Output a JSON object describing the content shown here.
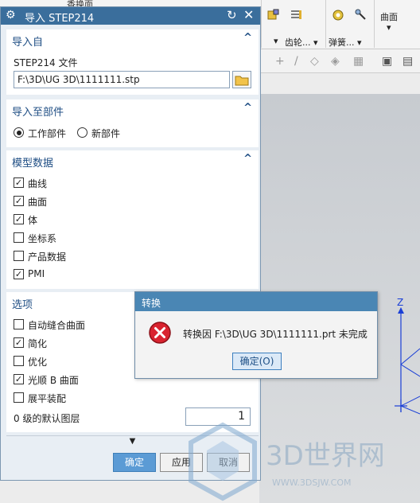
{
  "ribbon": {
    "top_label": "香换面",
    "items": [
      {
        "label": "齿轮...",
        "icon": "gear-tooth-icon"
      },
      {
        "label": "弹簧...",
        "icon": "spring-icon"
      },
      {
        "label": "曲面",
        "icon": "surface-icon"
      }
    ]
  },
  "dialog": {
    "title": "导入 STEP214",
    "import_from": {
      "header": "导入自",
      "file_label": "STEP214 文件",
      "file_path": "F:\\3D\\UG 3D\\1111111.stp"
    },
    "import_to": {
      "header": "导入至部件",
      "options": [
        {
          "label": "工作部件",
          "selected": true
        },
        {
          "label": "新部件",
          "selected": false
        }
      ]
    },
    "model_data": {
      "header": "模型数据",
      "items": [
        {
          "label": "曲线",
          "checked": true
        },
        {
          "label": "曲面",
          "checked": true
        },
        {
          "label": "体",
          "checked": true
        },
        {
          "label": "坐标系",
          "checked": false
        },
        {
          "label": "产品数据",
          "checked": false
        },
        {
          "label": "PMI",
          "checked": true
        }
      ]
    },
    "options": {
      "header": "选项",
      "items": [
        {
          "label": "自动缝合曲面",
          "checked": false
        },
        {
          "label": "简化",
          "checked": true
        },
        {
          "label": "优化",
          "checked": false
        },
        {
          "label": "光顺 B 曲面",
          "checked": true
        },
        {
          "label": "展平装配",
          "checked": false
        }
      ],
      "layer_label": "0 级的默认图层",
      "layer_value": "1"
    },
    "buttons": {
      "ok": "确定",
      "apply": "应用",
      "cancel": "取消"
    }
  },
  "popup": {
    "title": "转换",
    "message": "转换因 F:\\3D\\UG 3D\\1111111.prt 未完成",
    "ok": "确定(O)"
  },
  "viewport": {
    "axis_label": "Z"
  },
  "watermark": {
    "brand": "3D世界网",
    "url": "WWW.3DSJW.COM"
  },
  "colors": {
    "title_bar": "#3a6e9c",
    "group_header": "#1f4e84",
    "primary_button": "#5b9bd5",
    "error_red": "#d9232f",
    "axis_blue": "#1a3fd6"
  }
}
